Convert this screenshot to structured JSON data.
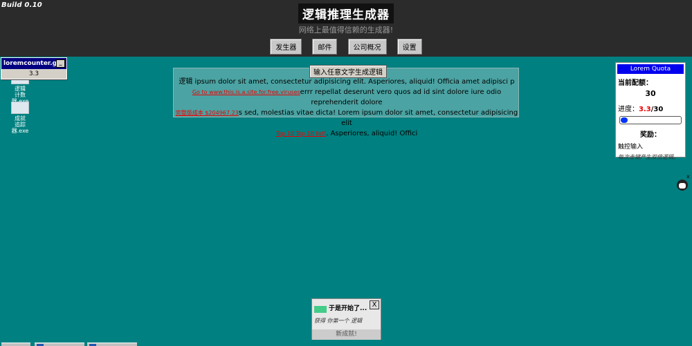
{
  "header": {
    "build": "Build 0.10",
    "title": "逻辑推理生成器",
    "subtitle": "网络上最值得信赖的生成器!",
    "nav": [
      "发生器",
      "邮件",
      "公司概况",
      "设置"
    ]
  },
  "counter_window": {
    "title": "loremcounter.gov",
    "value": "3.3"
  },
  "desktop_icons": [
    {
      "label_lines": [
        "逻辑",
        "计数",
        "器.exe"
      ],
      "icon": "document-icon"
    },
    {
      "label_lines": [
        "成就",
        "追踪",
        "器.exe"
      ],
      "icon": "folder-icon"
    }
  ],
  "panel": {
    "button": "输入任意文字生成逻辑",
    "line1": "逻辑 ipsum dolor sit amet, consectetur adipisicing elit. Asperiores, aliquid! Officia amet adipisci p",
    "line2_link": "Go to www.this.is.a.site.for.free.viruses",
    "line2_text": "errr repellat deserunt vero quos ad id sint dolore iure odio reprehenderit dolore",
    "line3_link": "完整版成本 $204967.23",
    "line3_text": "s sed, molestias vitae dicta! Lorem ipsum dolor sit amet, consectetur adipisicing elit",
    "line4_link": "Top 10 Top 10 list!",
    "line4_text": ". Asperiores, aliquid! Offici"
  },
  "quota": {
    "header": "Lorem Quota",
    "current_label": "当前配额：",
    "current_value": "30",
    "progress_label": "进度：",
    "progress_value": "3.3",
    "progress_total": "/30",
    "progress_fraction": 0.11,
    "reward_label": "奖励：",
    "reward_name": "触控输入",
    "reward_desc": "每次击键产生双倍逻辑。"
  },
  "side_close": "x",
  "notification": {
    "title": "于是开始了...",
    "body": "获得 你第一个 逻辑",
    "footer": "新成就!",
    "close": "X"
  },
  "colors": {
    "desktop": "#008080",
    "header": "#2b2b2b",
    "quota_header": "#0000ee",
    "progress_fill": "#0033ff",
    "link": "#ee0000"
  }
}
